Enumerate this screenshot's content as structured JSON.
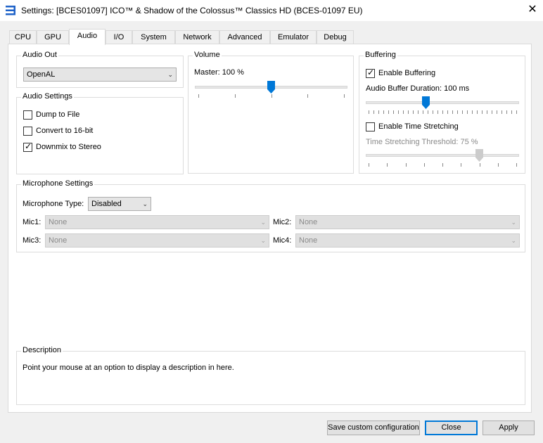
{
  "window": {
    "title": "Settings: [BCES01097] ICO™ & Shadow of the Colossus™ Classics HD (BCES-01097 EU)",
    "close_glyph": "✕"
  },
  "tabs": [
    {
      "label": "CPU"
    },
    {
      "label": "GPU"
    },
    {
      "label": "Audio",
      "active": true
    },
    {
      "label": "I/O"
    },
    {
      "label": "System"
    },
    {
      "label": "Network"
    },
    {
      "label": "Advanced"
    },
    {
      "label": "Emulator"
    },
    {
      "label": "Debug"
    }
  ],
  "audio_out": {
    "title": "Audio Out",
    "selected": "OpenAL"
  },
  "audio_settings": {
    "title": "Audio Settings",
    "items": [
      {
        "label": "Dump to File",
        "checked": false
      },
      {
        "label": "Convert to 16-bit",
        "checked": false
      },
      {
        "label": "Downmix to Stereo",
        "checked": true
      }
    ]
  },
  "volume": {
    "title": "Volume",
    "master_label": "Master: 100 %",
    "master_value_fraction": 0.5
  },
  "buffering": {
    "title": "Buffering",
    "enable_buffering_label": "Enable Buffering",
    "enable_buffering_checked": true,
    "duration_label": "Audio Buffer Duration: 100 ms",
    "duration_value_fraction": 0.39,
    "enable_stretch_label": "Enable Time Stretching",
    "enable_stretch_checked": false,
    "stretch_label": "Time Stretching Threshold: 75 %",
    "stretch_value_fraction": 0.74
  },
  "microphone": {
    "title": "Microphone Settings",
    "type_label": "Microphone Type:",
    "type_selected": "Disabled",
    "mic1_label": "Mic1:",
    "mic1_value": "None",
    "mic2_label": "Mic2:",
    "mic2_value": "None",
    "mic3_label": "Mic3:",
    "mic3_value": "None",
    "mic4_label": "Mic4:",
    "mic4_value": "None"
  },
  "description": {
    "title": "Description",
    "text": "Point your mouse at an option to display a description in here."
  },
  "buttons": {
    "save_custom": "Save custom configuration",
    "close": "Close",
    "apply": "Apply"
  },
  "colors": {
    "accent": "#0078d7",
    "disabled_thumb": "#cccccc"
  }
}
